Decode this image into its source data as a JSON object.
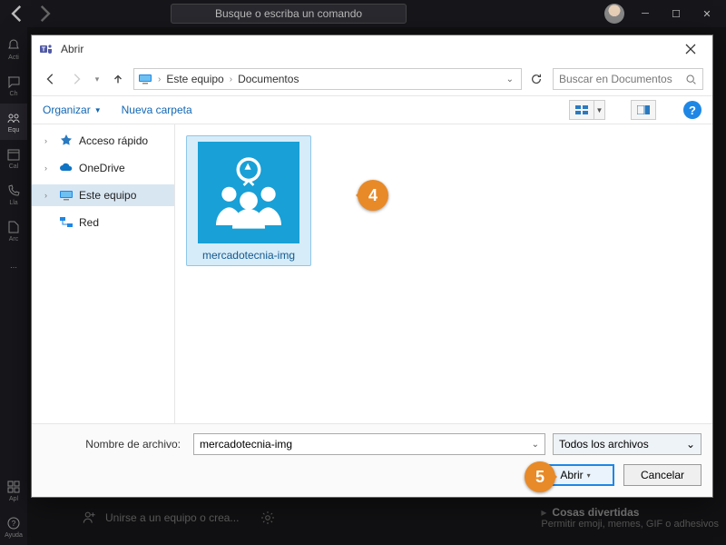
{
  "teams": {
    "search_placeholder": "Busque o escriba un comando",
    "rail": [
      "Acti",
      "Ch",
      "Equ",
      "Cal",
      "Lla",
      "Arc",
      "",
      "Apl",
      "Ayuda"
    ],
    "bottom_join": "Unirse a un equipo o crea...",
    "fun_title": "Cosas divertidas",
    "fun_sub": "Permitir emoji, memes, GIF o adhesivos"
  },
  "dialog": {
    "title": "Abrir",
    "breadcrumb": {
      "root": "Este equipo",
      "folder": "Documentos"
    },
    "search_placeholder": "Buscar en Documentos",
    "toolbar": {
      "organize": "Organizar",
      "new_folder": "Nueva carpeta"
    },
    "tree": {
      "quick": "Acceso rápido",
      "onedrive": "OneDrive",
      "thispc": "Este equipo",
      "network": "Red"
    },
    "file": {
      "name": "mercadotecnia-img"
    },
    "footer": {
      "label": "Nombre de archivo:",
      "filename": "mercadotecnia-img",
      "filter": "Todos los archivos",
      "open": "Abrir",
      "cancel": "Cancelar"
    }
  },
  "callouts": {
    "c4": "4",
    "c5": "5"
  }
}
